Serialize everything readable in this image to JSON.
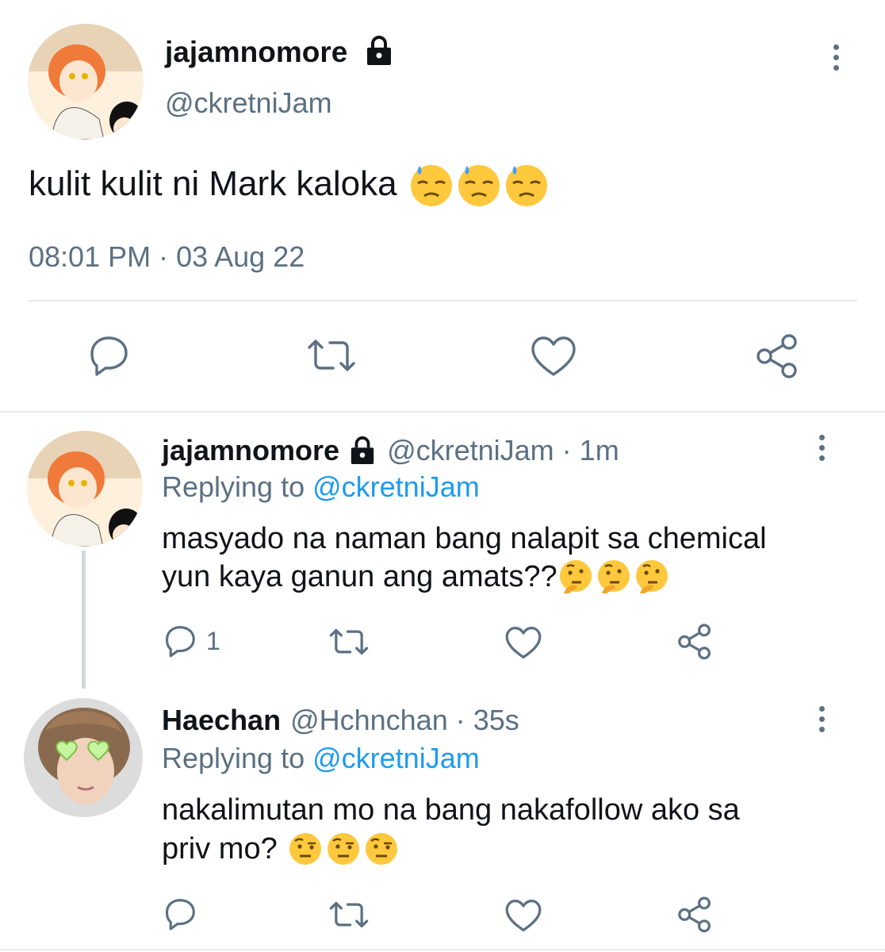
{
  "main_tweet": {
    "display_name": "jajamnomore",
    "handle": "@ckretniJam",
    "text": "kulit kulit ni Mark kaloka",
    "text_emojis": [
      "sweat-face",
      "sweat-face",
      "sweat-face"
    ],
    "timestamp": "08:01 PM · 03 Aug 22",
    "actions": [
      "reply-icon",
      "retweet-icon",
      "like-icon",
      "share-icon"
    ]
  },
  "replies": [
    {
      "display_name": "jajamnomore",
      "handle": "@ckretniJam",
      "time_sep": "·",
      "time": "1m",
      "replying_prefix": "Replying to",
      "replying_handle": "@ckretniJam",
      "text_line1": "masyado na naman bang nalapit sa chemical",
      "text_line2": "yun kaya ganun ang amats??",
      "text_emojis": [
        "thinking-face",
        "thinking-face",
        "thinking-face"
      ],
      "reply_count": "1"
    },
    {
      "display_name": "Haechan",
      "handle": "@Hchnchan",
      "time_sep": "·",
      "time": "35s",
      "replying_prefix": "Replying to",
      "replying_handle": "@ckretniJam",
      "text_line1": "nakalimutan mo na bang nakafollow ako sa",
      "text_line2": "priv mo?",
      "text_emojis": [
        "raised-eyebrow-face",
        "raised-eyebrow-face",
        "raised-eyebrow-face"
      ],
      "reply_count": ""
    }
  ],
  "colors": {
    "text": "#0f1419",
    "secondary": "#5b7083",
    "link": "#1d9bf0",
    "divider": "#e6ecf0"
  }
}
